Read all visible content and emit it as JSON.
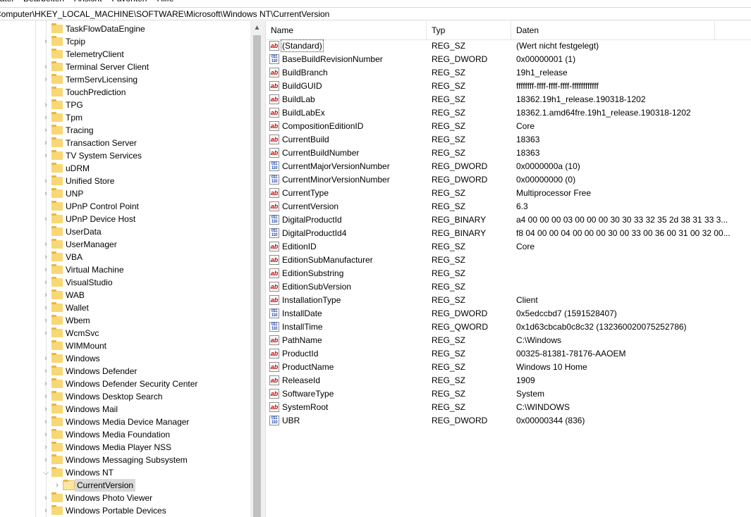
{
  "menu": [
    "Datei",
    "Bearbeiten",
    "Ansicht",
    "Favoriten",
    "Hilfe"
  ],
  "address": "Computer\\HKEY_LOCAL_MACHINE\\SOFTWARE\\Microsoft\\Windows NT\\CurrentVersion",
  "tree": {
    "items": [
      {
        "label": "TaskFlowDataEngine",
        "has_children": false
      },
      {
        "label": "Tcpip",
        "has_children": true
      },
      {
        "label": "TelemetryClient",
        "has_children": false
      },
      {
        "label": "Terminal Server Client",
        "has_children": true
      },
      {
        "label": "TermServLicensing",
        "has_children": true
      },
      {
        "label": "TouchPrediction",
        "has_children": false
      },
      {
        "label": "TPG",
        "has_children": true
      },
      {
        "label": "Tpm",
        "has_children": true
      },
      {
        "label": "Tracing",
        "has_children": true
      },
      {
        "label": "Transaction Server",
        "has_children": true
      },
      {
        "label": "TV System Services",
        "has_children": true
      },
      {
        "label": "uDRM",
        "has_children": false
      },
      {
        "label": "Unified Store",
        "has_children": true
      },
      {
        "label": "UNP",
        "has_children": true
      },
      {
        "label": "UPnP Control Point",
        "has_children": false
      },
      {
        "label": "UPnP Device Host",
        "has_children": true
      },
      {
        "label": "UserData",
        "has_children": false
      },
      {
        "label": "UserManager",
        "has_children": true
      },
      {
        "label": "VBA",
        "has_children": true
      },
      {
        "label": "Virtual Machine",
        "has_children": true
      },
      {
        "label": "VisualStudio",
        "has_children": true
      },
      {
        "label": "WAB",
        "has_children": true
      },
      {
        "label": "Wallet",
        "has_children": true
      },
      {
        "label": "Wbem",
        "has_children": true
      },
      {
        "label": "WcmSvc",
        "has_children": true
      },
      {
        "label": "WIMMount",
        "has_children": false
      },
      {
        "label": "Windows",
        "has_children": true
      },
      {
        "label": "Windows Defender",
        "has_children": true
      },
      {
        "label": "Windows Defender Security Center",
        "has_children": true
      },
      {
        "label": "Windows Desktop Search",
        "has_children": true
      },
      {
        "label": "Windows Mail",
        "has_children": true
      },
      {
        "label": "Windows Media Device Manager",
        "has_children": true
      },
      {
        "label": "Windows Media Foundation",
        "has_children": true
      },
      {
        "label": "Windows Media Player NSS",
        "has_children": true
      },
      {
        "label": "Windows Messaging Subsystem",
        "has_children": true
      },
      {
        "label": "Windows NT",
        "has_children": true,
        "expanded": true
      },
      {
        "label": "CurrentVersion",
        "has_children": true,
        "child": true,
        "selected": true
      },
      {
        "label": "Windows Photo Viewer",
        "has_children": true
      },
      {
        "label": "Windows Portable Devices",
        "has_children": true
      }
    ]
  },
  "list": {
    "columns": [
      "Name",
      "Typ",
      "Daten"
    ],
    "rows": [
      {
        "name": "(Standard)",
        "type": "REG_SZ",
        "data": "(Wert nicht festgelegt)",
        "icon": "string-value-icon"
      },
      {
        "name": "BaseBuildRevisionNumber",
        "type": "REG_DWORD",
        "data": "0x00000001 (1)",
        "icon": "binary-value-icon"
      },
      {
        "name": "BuildBranch",
        "type": "REG_SZ",
        "data": "19h1_release",
        "icon": "string-value-icon"
      },
      {
        "name": "BuildGUID",
        "type": "REG_SZ",
        "data": "ffffffff-ffff-ffff-ffff-ffffffffffff",
        "icon": "string-value-icon"
      },
      {
        "name": "BuildLab",
        "type": "REG_SZ",
        "data": "18362.19h1_release.190318-1202",
        "icon": "string-value-icon"
      },
      {
        "name": "BuildLabEx",
        "type": "REG_SZ",
        "data": "18362.1.amd64fre.19h1_release.190318-1202",
        "icon": "string-value-icon"
      },
      {
        "name": "CompositionEditionID",
        "type": "REG_SZ",
        "data": "Core",
        "icon": "string-value-icon"
      },
      {
        "name": "CurrentBuild",
        "type": "REG_SZ",
        "data": "18363",
        "icon": "string-value-icon"
      },
      {
        "name": "CurrentBuildNumber",
        "type": "REG_SZ",
        "data": "18363",
        "icon": "string-value-icon"
      },
      {
        "name": "CurrentMajorVersionNumber",
        "type": "REG_DWORD",
        "data": "0x0000000a (10)",
        "icon": "binary-value-icon"
      },
      {
        "name": "CurrentMinorVersionNumber",
        "type": "REG_DWORD",
        "data": "0x00000000 (0)",
        "icon": "binary-value-icon"
      },
      {
        "name": "CurrentType",
        "type": "REG_SZ",
        "data": "Multiprocessor Free",
        "icon": "string-value-icon"
      },
      {
        "name": "CurrentVersion",
        "type": "REG_SZ",
        "data": "6.3",
        "icon": "string-value-icon"
      },
      {
        "name": "DigitalProductId",
        "type": "REG_BINARY",
        "data": "a4 00 00 00 03 00 00 00 30 30 33 32 35 2d 38 31 33 3...",
        "icon": "binary-value-icon"
      },
      {
        "name": "DigitalProductId4",
        "type": "REG_BINARY",
        "data": "f8 04 00 00 04 00 00 00 30 00 33 00 36 00 31 00 32 00...",
        "icon": "binary-value-icon"
      },
      {
        "name": "EditionID",
        "type": "REG_SZ",
        "data": "Core",
        "icon": "string-value-icon"
      },
      {
        "name": "EditionSubManufacturer",
        "type": "REG_SZ",
        "data": "",
        "icon": "string-value-icon"
      },
      {
        "name": "EditionSubstring",
        "type": "REG_SZ",
        "data": "",
        "icon": "string-value-icon"
      },
      {
        "name": "EditionSubVersion",
        "type": "REG_SZ",
        "data": "",
        "icon": "string-value-icon"
      },
      {
        "name": "InstallationType",
        "type": "REG_SZ",
        "data": "Client",
        "icon": "string-value-icon"
      },
      {
        "name": "InstallDate",
        "type": "REG_DWORD",
        "data": "0x5edccbd7 (1591528407)",
        "icon": "binary-value-icon"
      },
      {
        "name": "InstallTime",
        "type": "REG_QWORD",
        "data": "0x1d63cbcab0c8c32 (132360020075252786)",
        "icon": "binary-value-icon"
      },
      {
        "name": "PathName",
        "type": "REG_SZ",
        "data": "C:\\Windows",
        "icon": "string-value-icon"
      },
      {
        "name": "ProductId",
        "type": "REG_SZ",
        "data": "00325-81381-78176-AAOEM",
        "icon": "string-value-icon"
      },
      {
        "name": "ProductName",
        "type": "REG_SZ",
        "data": "Windows 10 Home",
        "icon": "string-value-icon"
      },
      {
        "name": "ReleaseId",
        "type": "REG_SZ",
        "data": "1909",
        "icon": "string-value-icon"
      },
      {
        "name": "SoftwareType",
        "type": "REG_SZ",
        "data": "System",
        "icon": "string-value-icon"
      },
      {
        "name": "SystemRoot",
        "type": "REG_SZ",
        "data": "C:\\WINDOWS",
        "icon": "string-value-icon"
      },
      {
        "name": "UBR",
        "type": "REG_DWORD",
        "data": "0x00000344 (836)",
        "icon": "binary-value-icon"
      }
    ]
  },
  "colors": {
    "folder": "#f8d775",
    "selection": "#d9d9d9",
    "string_icon": "#c00000",
    "binary_icon": "#1f4fb5"
  }
}
